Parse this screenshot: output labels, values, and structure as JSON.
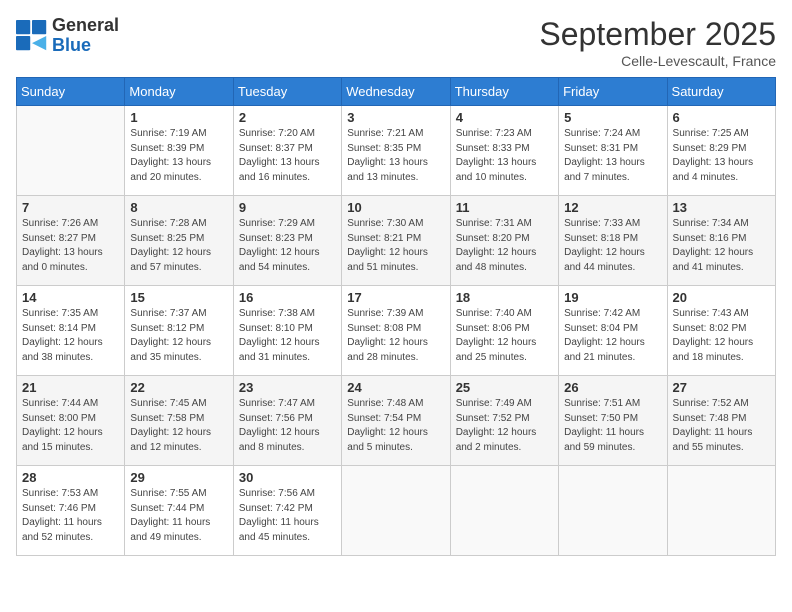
{
  "header": {
    "logo": {
      "general": "General",
      "blue": "Blue"
    },
    "title": "September 2025",
    "location": "Celle-Levescault, France"
  },
  "days_of_week": [
    "Sunday",
    "Monday",
    "Tuesday",
    "Wednesday",
    "Thursday",
    "Friday",
    "Saturday"
  ],
  "weeks": [
    [
      {
        "day": "",
        "info": ""
      },
      {
        "day": "1",
        "info": "Sunrise: 7:19 AM\nSunset: 8:39 PM\nDaylight: 13 hours\nand 20 minutes."
      },
      {
        "day": "2",
        "info": "Sunrise: 7:20 AM\nSunset: 8:37 PM\nDaylight: 13 hours\nand 16 minutes."
      },
      {
        "day": "3",
        "info": "Sunrise: 7:21 AM\nSunset: 8:35 PM\nDaylight: 13 hours\nand 13 minutes."
      },
      {
        "day": "4",
        "info": "Sunrise: 7:23 AM\nSunset: 8:33 PM\nDaylight: 13 hours\nand 10 minutes."
      },
      {
        "day": "5",
        "info": "Sunrise: 7:24 AM\nSunset: 8:31 PM\nDaylight: 13 hours\nand 7 minutes."
      },
      {
        "day": "6",
        "info": "Sunrise: 7:25 AM\nSunset: 8:29 PM\nDaylight: 13 hours\nand 4 minutes."
      }
    ],
    [
      {
        "day": "7",
        "info": "Sunrise: 7:26 AM\nSunset: 8:27 PM\nDaylight: 13 hours\nand 0 minutes."
      },
      {
        "day": "8",
        "info": "Sunrise: 7:28 AM\nSunset: 8:25 PM\nDaylight: 12 hours\nand 57 minutes."
      },
      {
        "day": "9",
        "info": "Sunrise: 7:29 AM\nSunset: 8:23 PM\nDaylight: 12 hours\nand 54 minutes."
      },
      {
        "day": "10",
        "info": "Sunrise: 7:30 AM\nSunset: 8:21 PM\nDaylight: 12 hours\nand 51 minutes."
      },
      {
        "day": "11",
        "info": "Sunrise: 7:31 AM\nSunset: 8:20 PM\nDaylight: 12 hours\nand 48 minutes."
      },
      {
        "day": "12",
        "info": "Sunrise: 7:33 AM\nSunset: 8:18 PM\nDaylight: 12 hours\nand 44 minutes."
      },
      {
        "day": "13",
        "info": "Sunrise: 7:34 AM\nSunset: 8:16 PM\nDaylight: 12 hours\nand 41 minutes."
      }
    ],
    [
      {
        "day": "14",
        "info": "Sunrise: 7:35 AM\nSunset: 8:14 PM\nDaylight: 12 hours\nand 38 minutes."
      },
      {
        "day": "15",
        "info": "Sunrise: 7:37 AM\nSunset: 8:12 PM\nDaylight: 12 hours\nand 35 minutes."
      },
      {
        "day": "16",
        "info": "Sunrise: 7:38 AM\nSunset: 8:10 PM\nDaylight: 12 hours\nand 31 minutes."
      },
      {
        "day": "17",
        "info": "Sunrise: 7:39 AM\nSunset: 8:08 PM\nDaylight: 12 hours\nand 28 minutes."
      },
      {
        "day": "18",
        "info": "Sunrise: 7:40 AM\nSunset: 8:06 PM\nDaylight: 12 hours\nand 25 minutes."
      },
      {
        "day": "19",
        "info": "Sunrise: 7:42 AM\nSunset: 8:04 PM\nDaylight: 12 hours\nand 21 minutes."
      },
      {
        "day": "20",
        "info": "Sunrise: 7:43 AM\nSunset: 8:02 PM\nDaylight: 12 hours\nand 18 minutes."
      }
    ],
    [
      {
        "day": "21",
        "info": "Sunrise: 7:44 AM\nSunset: 8:00 PM\nDaylight: 12 hours\nand 15 minutes."
      },
      {
        "day": "22",
        "info": "Sunrise: 7:45 AM\nSunset: 7:58 PM\nDaylight: 12 hours\nand 12 minutes."
      },
      {
        "day": "23",
        "info": "Sunrise: 7:47 AM\nSunset: 7:56 PM\nDaylight: 12 hours\nand 8 minutes."
      },
      {
        "day": "24",
        "info": "Sunrise: 7:48 AM\nSunset: 7:54 PM\nDaylight: 12 hours\nand 5 minutes."
      },
      {
        "day": "25",
        "info": "Sunrise: 7:49 AM\nSunset: 7:52 PM\nDaylight: 12 hours\nand 2 minutes."
      },
      {
        "day": "26",
        "info": "Sunrise: 7:51 AM\nSunset: 7:50 PM\nDaylight: 11 hours\nand 59 minutes."
      },
      {
        "day": "27",
        "info": "Sunrise: 7:52 AM\nSunset: 7:48 PM\nDaylight: 11 hours\nand 55 minutes."
      }
    ],
    [
      {
        "day": "28",
        "info": "Sunrise: 7:53 AM\nSunset: 7:46 PM\nDaylight: 11 hours\nand 52 minutes."
      },
      {
        "day": "29",
        "info": "Sunrise: 7:55 AM\nSunset: 7:44 PM\nDaylight: 11 hours\nand 49 minutes."
      },
      {
        "day": "30",
        "info": "Sunrise: 7:56 AM\nSunset: 7:42 PM\nDaylight: 11 hours\nand 45 minutes."
      },
      {
        "day": "",
        "info": ""
      },
      {
        "day": "",
        "info": ""
      },
      {
        "day": "",
        "info": ""
      },
      {
        "day": "",
        "info": ""
      }
    ]
  ]
}
